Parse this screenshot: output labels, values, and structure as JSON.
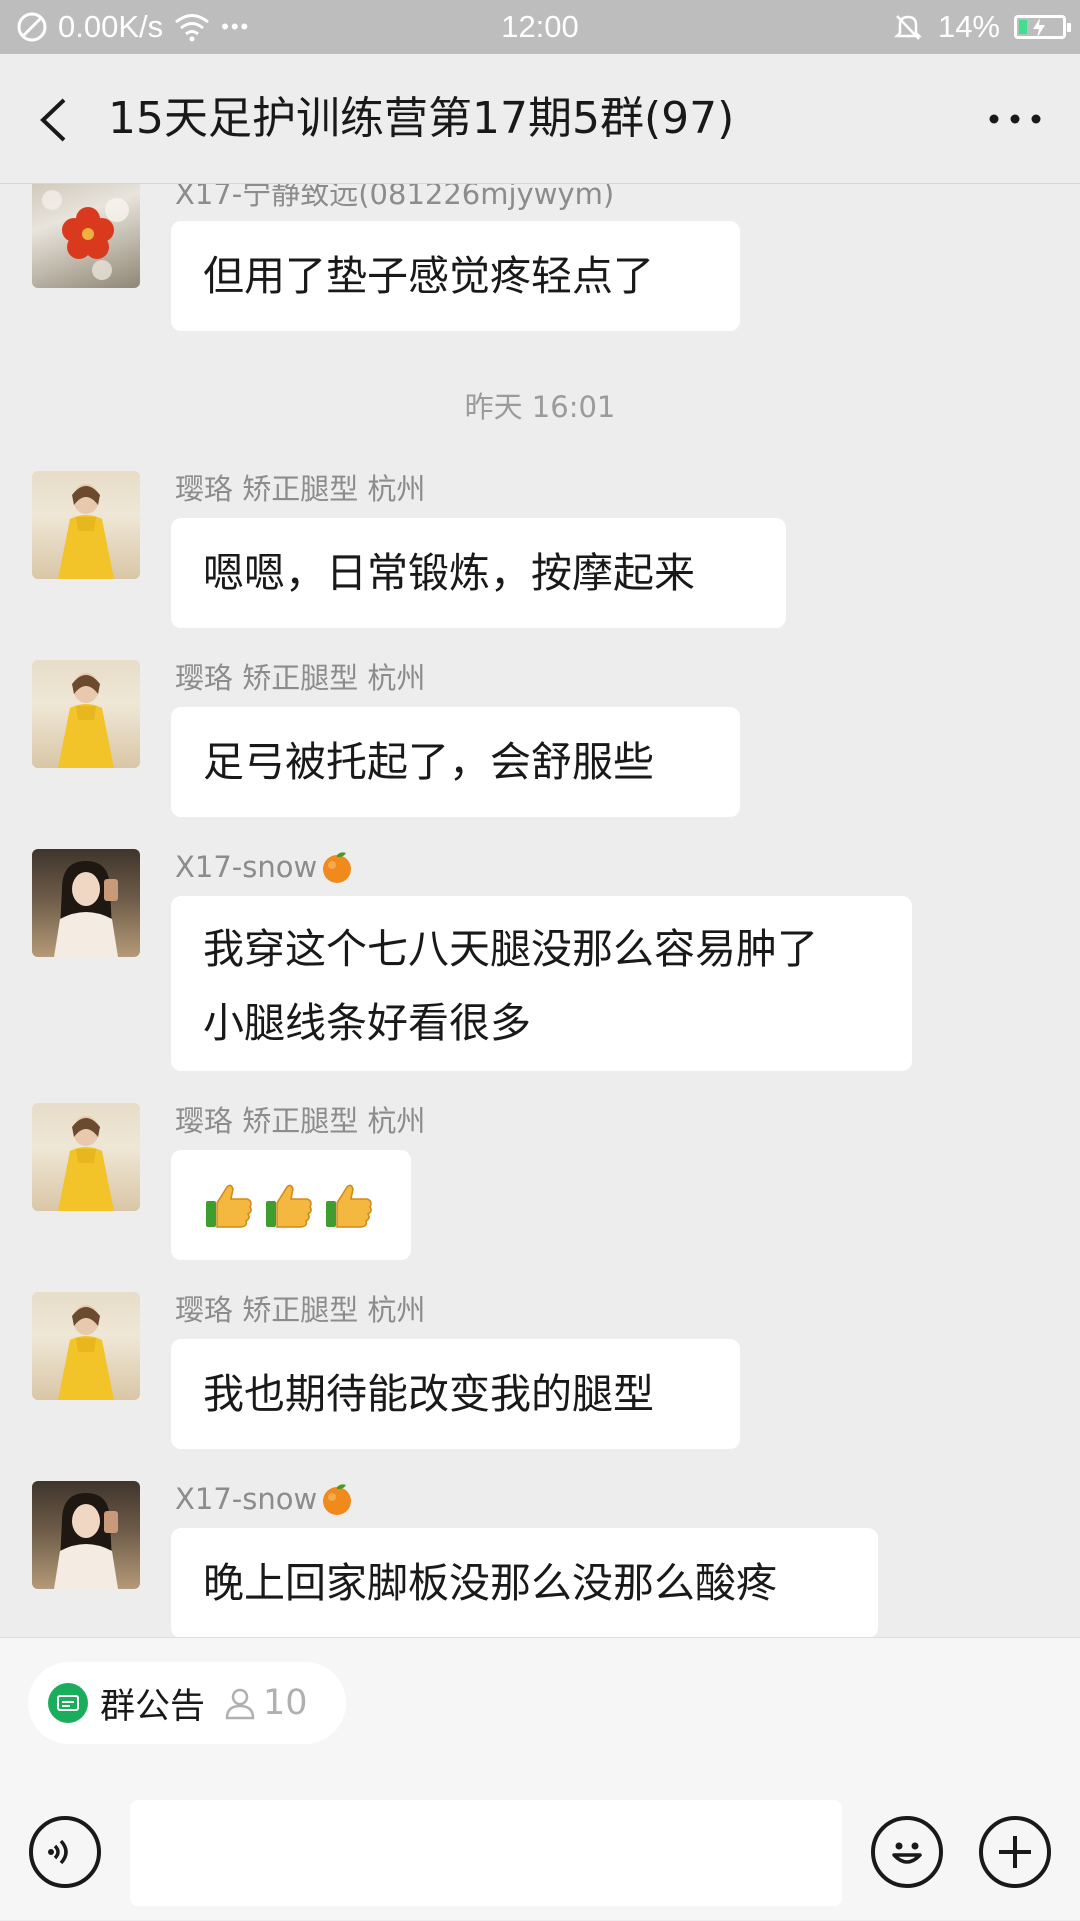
{
  "status_bar": {
    "speed": "0.00K/s",
    "dots": "•••",
    "time": "12:00",
    "battery": "14%"
  },
  "header": {
    "title": "15天足护训练营第17期5群(97)"
  },
  "messages": [
    {
      "sender": "X17-宁静致远(081226mjywym)",
      "text": "但用了垫子感觉疼轻点了",
      "avatar": "flower"
    },
    {
      "timestamp": "昨天 16:01"
    },
    {
      "sender": "璎珞  矫正腿型 杭州",
      "text": "嗯嗯，日常锻炼，按摩起来",
      "avatar": "yellow-dress"
    },
    {
      "sender": "璎珞  矫正腿型 杭州",
      "text": "足弓被托起了，会舒服些",
      "avatar": "yellow-dress"
    },
    {
      "sender": "X17-snow",
      "sender_emoji": "orange-icon",
      "text_lines": [
        "我穿这个七八天腿没那么容易肿了",
        "小腿线条好看很多"
      ],
      "avatar": "snow"
    },
    {
      "sender": "璎珞  矫正腿型 杭州",
      "emojis": [
        "thumbs-up",
        "thumbs-up",
        "thumbs-up"
      ],
      "avatar": "yellow-dress"
    },
    {
      "sender": "璎珞  矫正腿型 杭州",
      "text": "我也期待能改变我的腿型",
      "avatar": "yellow-dress"
    },
    {
      "sender": "X17-snow",
      "sender_emoji": "orange-icon",
      "text": "晚上回家脚板没那么没那么酸疼",
      "avatar": "snow"
    }
  ],
  "notice": {
    "label": "群公告",
    "count": "10"
  },
  "input": {
    "placeholder": ""
  },
  "colors": {
    "accent_green": "#1aad5c",
    "background": "#ededed",
    "bubble": "#ffffff"
  }
}
